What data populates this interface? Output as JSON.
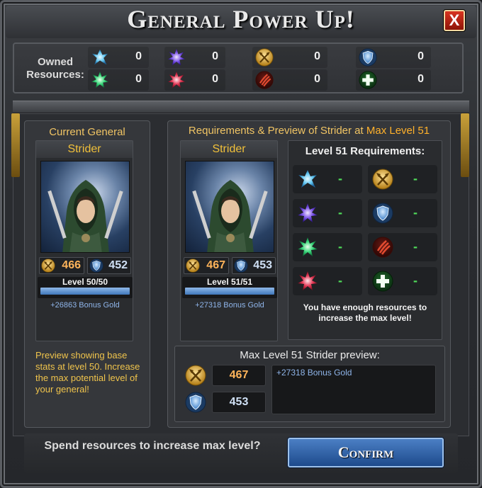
{
  "title": "General Power Up!",
  "close_label": "X",
  "owned": {
    "label": "Owned Resources:",
    "items": [
      {
        "icon": "blue-crystal-icon",
        "value": "0"
      },
      {
        "icon": "purple-crystal-icon",
        "value": "0"
      },
      {
        "icon": "attack-axe-icon",
        "value": "0"
      },
      {
        "icon": "defense-shield-icon",
        "value": "0"
      },
      {
        "icon": "green-crystal-icon",
        "value": "0"
      },
      {
        "icon": "red-crystal-icon",
        "value": "0"
      },
      {
        "icon": "claw-marks-icon",
        "value": "0"
      },
      {
        "icon": "health-plus-icon",
        "value": "0"
      }
    ]
  },
  "current": {
    "heading": "Current General",
    "name": "Strider",
    "attack": "466",
    "defense": "452",
    "level_text": "Level 50/50",
    "level_progress": 1.0,
    "bonus": "+26863 Bonus Gold",
    "description": "Preview showing base stats at level 50. Increase the max potential level of your general!"
  },
  "preview": {
    "heading_prefix": "Requirements & Preview of Strider at ",
    "heading_highlight": "Max Level 51",
    "name": "Strider",
    "attack": "467",
    "defense": "453",
    "level_text": "Level 51/51",
    "level_progress": 1.0,
    "bonus": "+27318 Bonus Gold"
  },
  "requirements": {
    "title": "Level 51 Requirements:",
    "items": [
      {
        "icon": "blue-crystal-icon",
        "value": "-"
      },
      {
        "icon": "attack-axe-icon",
        "value": "-"
      },
      {
        "icon": "purple-crystal-icon",
        "value": "-"
      },
      {
        "icon": "defense-shield-icon",
        "value": "-"
      },
      {
        "icon": "green-crystal-icon",
        "value": "-"
      },
      {
        "icon": "claw-marks-icon",
        "value": "-"
      },
      {
        "icon": "red-crystal-icon",
        "value": "-"
      },
      {
        "icon": "health-plus-icon",
        "value": "-"
      }
    ],
    "message": "You have enough resources to increase the max level!"
  },
  "max_preview": {
    "title": "Max Level 51 Strider preview:",
    "attack": "467",
    "defense": "453",
    "bonus": "+27318 Bonus Gold"
  },
  "footer": {
    "prompt": "Spend resources to increase max level?",
    "confirm_label": "Confirm"
  },
  "colors": {
    "gold_text": "#f0c03a",
    "attack_value": "#ffb45a",
    "defense_value": "#cfe0f5",
    "bonus_blue": "#8fb5ea",
    "ok_green": "#4fda5a",
    "confirm_blue": "#2d5fa8"
  }
}
